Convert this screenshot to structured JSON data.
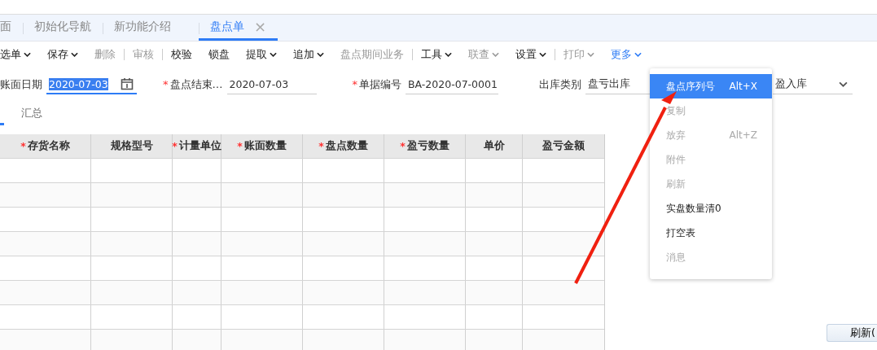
{
  "tabs": [
    {
      "label": "面",
      "selected": false,
      "closable": false
    },
    {
      "label": "初始化导航",
      "selected": false,
      "closable": false
    },
    {
      "label": "新功能介绍",
      "selected": false,
      "closable": false
    },
    {
      "label": "盘点单",
      "selected": true,
      "closable": true,
      "close": "×"
    }
  ],
  "toolbar": [
    {
      "kind": "button",
      "label": "选单",
      "caret": true,
      "disabled": false,
      "active": false
    },
    {
      "kind": "button",
      "label": "保存",
      "caret": true,
      "disabled": false,
      "active": false
    },
    {
      "kind": "button",
      "label": "删除",
      "caret": false,
      "disabled": true,
      "active": false
    },
    {
      "kind": "separator"
    },
    {
      "kind": "button",
      "label": "审核",
      "caret": false,
      "disabled": true,
      "active": false
    },
    {
      "kind": "separator"
    },
    {
      "kind": "button",
      "label": "校验",
      "caret": false,
      "disabled": false,
      "active": false
    },
    {
      "kind": "button",
      "label": "锁盘",
      "caret": false,
      "disabled": false,
      "active": false
    },
    {
      "kind": "button",
      "label": "提取",
      "caret": true,
      "disabled": false,
      "active": false
    },
    {
      "kind": "button",
      "label": "追加",
      "caret": true,
      "disabled": false,
      "active": false
    },
    {
      "kind": "button",
      "label": "盘点期间业务",
      "caret": false,
      "disabled": true,
      "active": false
    },
    {
      "kind": "separator"
    },
    {
      "kind": "button",
      "label": "工具",
      "caret": true,
      "disabled": false,
      "active": false
    },
    {
      "kind": "button",
      "label": "联查",
      "caret": true,
      "disabled": true,
      "active": false
    },
    {
      "kind": "button",
      "label": "设置",
      "caret": true,
      "disabled": false,
      "active": false
    },
    {
      "kind": "separator"
    },
    {
      "kind": "button",
      "label": "打印",
      "caret": true,
      "disabled": true,
      "active": false
    },
    {
      "kind": "button",
      "label": "更多",
      "caret": true,
      "disabled": false,
      "active": true
    }
  ],
  "form": [
    {
      "label": "账面日期",
      "value": "2020-07-03",
      "focused": true,
      "calendar": true
    },
    {
      "required_mark": "*",
      "label": "盘点结束…",
      "value": "2020-07-03",
      "focused": false
    },
    {
      "required_mark": "*",
      "label": "单据编号",
      "value": "BA-2020-07-0001",
      "focused": false
    },
    {
      "label": "出库类别",
      "value": "盘亏出库",
      "focused": false
    }
  ],
  "inbound_field": {
    "value": "盈入库"
  },
  "subtabs": [
    {
      "label": "汇总",
      "selected": false
    }
  ],
  "table": {
    "columns": [
      {
        "required_mark": "*",
        "label": "存货名称"
      },
      {
        "label": "规格型号"
      },
      {
        "required_mark": "*",
        "label": "计量单位"
      },
      {
        "required_mark": "*",
        "label": "账面数量"
      },
      {
        "required_mark": "*",
        "label": "盘点数量"
      },
      {
        "required_mark": "*",
        "label": "盈亏数量"
      },
      {
        "label": "单价"
      },
      {
        "label": "盈亏金额"
      }
    ]
  },
  "more_menu": [
    {
      "label": "盘点序列号",
      "shortcut": "Alt+X",
      "selected": true,
      "disabled": false
    },
    {
      "label": "复制",
      "selected": false,
      "disabled": true
    },
    {
      "label": "放弃",
      "shortcut": "Alt+Z",
      "selected": false,
      "disabled": true
    },
    {
      "label": "附件",
      "selected": false,
      "disabled": true
    },
    {
      "label": "刷新",
      "selected": false,
      "disabled": true
    },
    {
      "label": "实盘数量清0",
      "selected": false,
      "disabled": false
    },
    {
      "label": "打空表",
      "selected": false,
      "disabled": false
    },
    {
      "label": "消息",
      "selected": false,
      "disabled": true
    }
  ],
  "refresh_button": {
    "label": "刷新("
  }
}
